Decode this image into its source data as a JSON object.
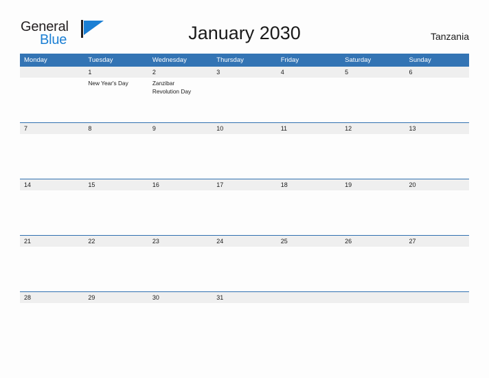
{
  "brand": {
    "name_part1": "General",
    "name_part2": "Blue",
    "flag_color": "#1b7fd4",
    "pole_color": "#231f20"
  },
  "header": {
    "title": "January 2030",
    "location": "Tanzania"
  },
  "theme": {
    "header_blue": "#3374b4",
    "row_line_blue": "#2f6fb0",
    "date_band_gray": "#efefef",
    "page_background": "#fdfdfd",
    "text_color": "#1a1a1a"
  },
  "calendar": {
    "weekdays": [
      "Monday",
      "Tuesday",
      "Wednesday",
      "Thursday",
      "Friday",
      "Saturday",
      "Sunday"
    ],
    "weeks": [
      {
        "days": [
          {
            "date": "",
            "events": []
          },
          {
            "date": "1",
            "events": [
              "New Year's Day"
            ]
          },
          {
            "date": "2",
            "events": [
              "Zanzibar",
              "Revolution Day"
            ]
          },
          {
            "date": "3",
            "events": []
          },
          {
            "date": "4",
            "events": []
          },
          {
            "date": "5",
            "events": []
          },
          {
            "date": "6",
            "events": []
          }
        ]
      },
      {
        "days": [
          {
            "date": "7",
            "events": []
          },
          {
            "date": "8",
            "events": []
          },
          {
            "date": "9",
            "events": []
          },
          {
            "date": "10",
            "events": []
          },
          {
            "date": "11",
            "events": []
          },
          {
            "date": "12",
            "events": []
          },
          {
            "date": "13",
            "events": []
          }
        ]
      },
      {
        "days": [
          {
            "date": "14",
            "events": []
          },
          {
            "date": "15",
            "events": []
          },
          {
            "date": "16",
            "events": []
          },
          {
            "date": "17",
            "events": []
          },
          {
            "date": "18",
            "events": []
          },
          {
            "date": "19",
            "events": []
          },
          {
            "date": "20",
            "events": []
          }
        ]
      },
      {
        "days": [
          {
            "date": "21",
            "events": []
          },
          {
            "date": "22",
            "events": []
          },
          {
            "date": "23",
            "events": []
          },
          {
            "date": "24",
            "events": []
          },
          {
            "date": "25",
            "events": []
          },
          {
            "date": "26",
            "events": []
          },
          {
            "date": "27",
            "events": []
          }
        ]
      },
      {
        "days": [
          {
            "date": "28",
            "events": []
          },
          {
            "date": "29",
            "events": []
          },
          {
            "date": "30",
            "events": []
          },
          {
            "date": "31",
            "events": []
          },
          {
            "date": "",
            "events": []
          },
          {
            "date": "",
            "events": []
          },
          {
            "date": "",
            "events": []
          }
        ]
      }
    ]
  }
}
